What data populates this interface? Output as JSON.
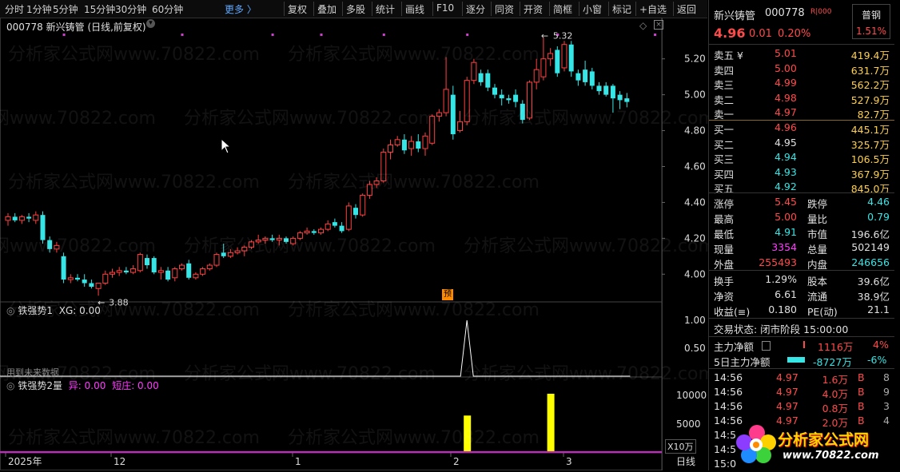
{
  "toolbar": {
    "periods": [
      "分时",
      "1分钟",
      "5分钟",
      "15分钟",
      "30分钟",
      "60分钟"
    ],
    "more": "更多 〉",
    "tools": [
      "复权",
      "叠加",
      "多股",
      "统计",
      "画线",
      "F10",
      "逐分",
      "同资",
      "开资",
      "简框",
      "小窗",
      "标记",
      "+自选",
      "返回"
    ]
  },
  "chart": {
    "title": "000778 新兴铸管 (日线,前复权)",
    "price_axis": [
      "5.20",
      "5.00",
      "4.80",
      "4.60",
      "4.40",
      "4.20",
      "4.00"
    ],
    "high_label": "5.32",
    "low_label": "3.88",
    "yu_badge": "预",
    "ind1_title": "铁强势1",
    "ind1_xg": "XG: 0.00",
    "ind1_axis": [
      "1.00",
      "0.50"
    ],
    "ind1_note": "用到未来数据",
    "ind2_title": "铁强势2量",
    "ind2_yi": "异: 0.00",
    "ind2_dq": "短庄: 0.00",
    "ind2_axis": [
      "10000",
      "5000"
    ],
    "x10": "X10万",
    "date_axis": [
      "2025年",
      "12",
      "1",
      "2",
      "3"
    ],
    "period_label": "日线",
    "watermark": "分析家公式网www.70822.com"
  },
  "chart_data": {
    "type": "candlestick",
    "series": [
      {
        "o": 4.3,
        "h": 4.34,
        "l": 4.27,
        "c": 4.32
      },
      {
        "o": 4.32,
        "h": 4.34,
        "l": 4.29,
        "c": 4.3
      },
      {
        "o": 4.3,
        "h": 4.33,
        "l": 4.28,
        "c": 4.32
      },
      {
        "o": 4.32,
        "h": 4.34,
        "l": 4.29,
        "c": 4.31
      },
      {
        "o": 4.3,
        "h": 4.35,
        "l": 4.28,
        "c": 4.33
      },
      {
        "o": 4.33,
        "h": 4.35,
        "l": 4.17,
        "c": 4.19
      },
      {
        "o": 4.19,
        "h": 4.21,
        "l": 4.12,
        "c": 4.14
      },
      {
        "o": 4.14,
        "h": 4.18,
        "l": 4.12,
        "c": 4.16
      },
      {
        "o": 4.1,
        "h": 4.12,
        "l": 3.95,
        "c": 3.97
      },
      {
        "o": 3.97,
        "h": 4.0,
        "l": 3.95,
        "c": 3.98
      },
      {
        "o": 3.98,
        "h": 4.0,
        "l": 3.96,
        "c": 3.97
      },
      {
        "o": 3.97,
        "h": 4.0,
        "l": 3.93,
        "c": 3.95
      },
      {
        "o": 3.95,
        "h": 3.97,
        "l": 3.92,
        "c": 3.93
      },
      {
        "o": 3.92,
        "h": 3.95,
        "l": 3.88,
        "c": 3.95
      },
      {
        "o": 3.95,
        "h": 4.02,
        "l": 3.94,
        "c": 4.0
      },
      {
        "o": 4.0,
        "h": 4.03,
        "l": 3.98,
        "c": 4.01
      },
      {
        "o": 4.01,
        "h": 4.04,
        "l": 3.99,
        "c": 4.02
      },
      {
        "o": 4.02,
        "h": 4.04,
        "l": 4.0,
        "c": 4.01
      },
      {
        "o": 4.01,
        "h": 4.05,
        "l": 4.0,
        "c": 4.03
      },
      {
        "o": 4.02,
        "h": 4.12,
        "l": 4.01,
        "c": 4.11
      },
      {
        "o": 4.09,
        "h": 4.11,
        "l": 4.03,
        "c": 4.05
      },
      {
        "o": 4.09,
        "h": 4.1,
        "l": 4.0,
        "c": 4.01
      },
      {
        "o": 4.01,
        "h": 4.04,
        "l": 3.97,
        "c": 4.02
      },
      {
        "o": 4.02,
        "h": 4.04,
        "l": 3.96,
        "c": 3.97
      },
      {
        "o": 3.98,
        "h": 4.04,
        "l": 3.96,
        "c": 4.03
      },
      {
        "o": 4.03,
        "h": 4.06,
        "l": 4.02,
        "c": 4.05
      },
      {
        "o": 4.06,
        "h": 4.08,
        "l": 3.97,
        "c": 3.98
      },
      {
        "o": 3.98,
        "h": 4.01,
        "l": 3.97,
        "c": 4.0
      },
      {
        "o": 4.0,
        "h": 4.04,
        "l": 3.99,
        "c": 4.03
      },
      {
        "o": 4.03,
        "h": 4.06,
        "l": 4.02,
        "c": 4.05
      },
      {
        "o": 4.05,
        "h": 4.12,
        "l": 4.04,
        "c": 4.11
      },
      {
        "o": 4.12,
        "h": 4.17,
        "l": 4.09,
        "c": 4.1
      },
      {
        "o": 4.1,
        "h": 4.14,
        "l": 4.09,
        "c": 4.12
      },
      {
        "o": 4.12,
        "h": 4.15,
        "l": 4.11,
        "c": 4.13
      },
      {
        "o": 4.13,
        "h": 4.16,
        "l": 4.1,
        "c": 4.15
      },
      {
        "o": 4.15,
        "h": 4.19,
        "l": 4.14,
        "c": 4.18
      },
      {
        "o": 4.18,
        "h": 4.22,
        "l": 4.17,
        "c": 4.19
      },
      {
        "o": 4.19,
        "h": 4.21,
        "l": 4.17,
        "c": 4.2
      },
      {
        "o": 4.2,
        "h": 4.22,
        "l": 4.18,
        "c": 4.19
      },
      {
        "o": 4.19,
        "h": 4.22,
        "l": 4.16,
        "c": 4.2
      },
      {
        "o": 4.2,
        "h": 4.21,
        "l": 4.17,
        "c": 4.18
      },
      {
        "o": 4.17,
        "h": 4.21,
        "l": 4.16,
        "c": 4.2
      },
      {
        "o": 4.2,
        "h": 4.24,
        "l": 4.19,
        "c": 4.23
      },
      {
        "o": 4.23,
        "h": 4.26,
        "l": 4.22,
        "c": 4.24
      },
      {
        "o": 4.24,
        "h": 4.25,
        "l": 4.22,
        "c": 4.23
      },
      {
        "o": 4.23,
        "h": 4.26,
        "l": 4.22,
        "c": 4.25
      },
      {
        "o": 4.25,
        "h": 4.3,
        "l": 4.24,
        "c": 4.28
      },
      {
        "o": 4.29,
        "h": 4.31,
        "l": 4.26,
        "c": 4.27
      },
      {
        "o": 4.27,
        "h": 4.29,
        "l": 4.23,
        "c": 4.24
      },
      {
        "o": 4.25,
        "h": 4.4,
        "l": 4.24,
        "c": 4.38
      },
      {
        "o": 4.37,
        "h": 4.39,
        "l": 4.31,
        "c": 4.33
      },
      {
        "o": 4.33,
        "h": 4.45,
        "l": 4.32,
        "c": 4.44
      },
      {
        "o": 4.44,
        "h": 4.52,
        "l": 4.42,
        "c": 4.5
      },
      {
        "o": 4.5,
        "h": 4.54,
        "l": 4.48,
        "c": 4.52
      },
      {
        "o": 4.52,
        "h": 4.7,
        "l": 4.51,
        "c": 4.68
      },
      {
        "o": 4.68,
        "h": 4.75,
        "l": 4.64,
        "c": 4.72
      },
      {
        "o": 4.72,
        "h": 4.77,
        "l": 4.71,
        "c": 4.75
      },
      {
        "o": 4.75,
        "h": 4.78,
        "l": 4.67,
        "c": 4.69
      },
      {
        "o": 4.7,
        "h": 4.77,
        "l": 4.66,
        "c": 4.74
      },
      {
        "o": 4.74,
        "h": 4.78,
        "l": 4.68,
        "c": 4.7
      },
      {
        "o": 4.7,
        "h": 4.79,
        "l": 4.66,
        "c": 4.77
      },
      {
        "o": 4.73,
        "h": 4.89,
        "l": 4.72,
        "c": 4.88
      },
      {
        "o": 4.88,
        "h": 4.92,
        "l": 4.85,
        "c": 4.9
      },
      {
        "o": 4.9,
        "h": 5.21,
        "l": 4.88,
        "c": 5.03
      },
      {
        "o": 5.0,
        "h": 5.05,
        "l": 4.75,
        "c": 4.78
      },
      {
        "o": 4.8,
        "h": 4.91,
        "l": 4.79,
        "c": 4.85
      },
      {
        "o": 4.85,
        "h": 5.1,
        "l": 4.83,
        "c": 5.08
      },
      {
        "o": 5.08,
        "h": 5.2,
        "l": 5.06,
        "c": 5.18
      },
      {
        "o": 5.12,
        "h": 5.14,
        "l": 5.05,
        "c": 5.07
      },
      {
        "o": 5.12,
        "h": 5.14,
        "l": 5.02,
        "c": 5.04
      },
      {
        "o": 5.04,
        "h": 5.06,
        "l": 4.98,
        "c": 5.0
      },
      {
        "o": 5.0,
        "h": 5.03,
        "l": 4.94,
        "c": 4.98
      },
      {
        "o": 4.98,
        "h": 5.0,
        "l": 4.95,
        "c": 4.97
      },
      {
        "o": 5.0,
        "h": 5.03,
        "l": 4.93,
        "c": 4.96
      },
      {
        "o": 4.95,
        "h": 4.97,
        "l": 4.84,
        "c": 4.86
      },
      {
        "o": 4.87,
        "h": 5.08,
        "l": 4.86,
        "c": 5.07
      },
      {
        "o": 5.07,
        "h": 5.2,
        "l": 5.03,
        "c": 5.14
      },
      {
        "o": 5.1,
        "h": 5.32,
        "l": 5.08,
        "c": 5.2
      },
      {
        "o": 5.2,
        "h": 5.26,
        "l": 5.16,
        "c": 5.23
      },
      {
        "o": 5.25,
        "h": 5.27,
        "l": 5.1,
        "c": 5.12
      },
      {
        "o": 5.15,
        "h": 5.3,
        "l": 5.13,
        "c": 5.28
      },
      {
        "o": 5.28,
        "h": 5.3,
        "l": 5.1,
        "c": 5.13
      },
      {
        "o": 5.12,
        "h": 5.14,
        "l": 5.05,
        "c": 5.08
      },
      {
        "o": 5.14,
        "h": 5.19,
        "l": 5.05,
        "c": 5.07
      },
      {
        "o": 5.13,
        "h": 5.15,
        "l": 5.03,
        "c": 5.05
      },
      {
        "o": 5.05,
        "h": 5.07,
        "l": 5.0,
        "c": 5.02
      },
      {
        "o": 5.05,
        "h": 5.07,
        "l": 4.99,
        "c": 5.0
      },
      {
        "o": 5.05,
        "h": 5.06,
        "l": 4.9,
        "c": 4.98
      },
      {
        "o": 5.0,
        "h": 5.02,
        "l": 4.92,
        "c": 4.97
      },
      {
        "o": 4.98,
        "h": 5.01,
        "l": 4.93,
        "c": 4.96
      }
    ],
    "ylim": [
      3.85,
      5.35
    ],
    "ind1_line": {
      "index": 66,
      "value": 1.0
    },
    "ind1_ylim": [
      0,
      1.1
    ],
    "ind2_bars": [
      {
        "index": 66,
        "value": 6500
      },
      {
        "index": 78,
        "value": 10300
      }
    ],
    "ind2_ylim": [
      0,
      11000
    ]
  },
  "panel": {
    "name": "新兴铸管",
    "code": "000778",
    "rz": "R|000",
    "badge": "普钢",
    "price": "4.96",
    "change": "0.01",
    "pct": "0.20%",
    "badge_pct": "1.51%",
    "asks": [
      {
        "label": "卖五 ¥",
        "price": "5.01",
        "vol": "419.4万"
      },
      {
        "label": "卖四",
        "price": "5.00",
        "vol": "631.7万"
      },
      {
        "label": "卖三",
        "price": "4.99",
        "vol": "562.2万"
      },
      {
        "label": "卖二",
        "price": "4.98",
        "vol": "527.9万"
      },
      {
        "label": "卖一",
        "price": "4.97",
        "vol": "82.7万"
      }
    ],
    "bids": [
      {
        "label": "买一",
        "price": "4.96",
        "vol": "445.1万"
      },
      {
        "label": "买二",
        "price": "4.95",
        "vol": "325.7万"
      },
      {
        "label": "买三",
        "price": "4.94",
        "vol": "106.5万"
      },
      {
        "label": "买四",
        "price": "4.93",
        "vol": "367.9万"
      },
      {
        "label": "买五",
        "price": "4.92",
        "vol": "845.0万"
      }
    ],
    "stats": [
      {
        "l1": "涨停",
        "v1": "5.45",
        "l2": "跌停",
        "v2": "4.46"
      },
      {
        "l1": "最高",
        "v1": "5.00",
        "l2": "量比",
        "v2": "0.79"
      },
      {
        "l1": "最低",
        "v1": "4.91",
        "l2": "市值",
        "v2": "196.6亿"
      },
      {
        "l1": "现量",
        "v1": "3354",
        "l2": "总量",
        "v2": "502149"
      },
      {
        "l1": "外盘",
        "v1": "255493",
        "l2": "内盘",
        "v2": "246656"
      }
    ],
    "stats2": [
      {
        "l1": "换手",
        "v1": "1.29%",
        "l2": "股本",
        "v2": "39.6亿"
      },
      {
        "l1": "净资",
        "v1": "6.61",
        "l2": "流通",
        "v2": "38.9亿"
      },
      {
        "l1": "收益(≡)",
        "v1": "0.180",
        "l2": "PE(动)",
        "v2": "21.1"
      }
    ],
    "trade_state": "交易状态: 闭市阶段 15:00:00",
    "zl_label": "主力净额",
    "zl_val": "1116万",
    "zl_pct": "4%",
    "zl5_label": "5日主力净额",
    "zl5_val": "-8727万",
    "zl5_pct": "-6%",
    "ticks": [
      {
        "t": "14:56",
        "p": "4.97",
        "v": "1.6万",
        "s": "B",
        "n": "8"
      },
      {
        "t": "14:56",
        "p": "4.97",
        "v": "4.0万",
        "s": "B",
        "n": "9"
      },
      {
        "t": "14:56",
        "p": "4.97",
        "v": "0.8万",
        "s": "B",
        "n": "3"
      },
      {
        "t": "14:56",
        "p": "4.97",
        "v": "2.0万",
        "s": "B",
        "n": "4"
      },
      {
        "t": "14:5",
        "p": "",
        "v": "",
        "s": "",
        "n": ""
      },
      {
        "t": "14:5",
        "p": "",
        "v": "",
        "s": "",
        "n": ""
      },
      {
        "t": "15:0",
        "p": "",
        "v": "",
        "s": "",
        "n": ""
      }
    ],
    "logo_text": "分析家公式网",
    "logo_url": "www.70822.com"
  }
}
